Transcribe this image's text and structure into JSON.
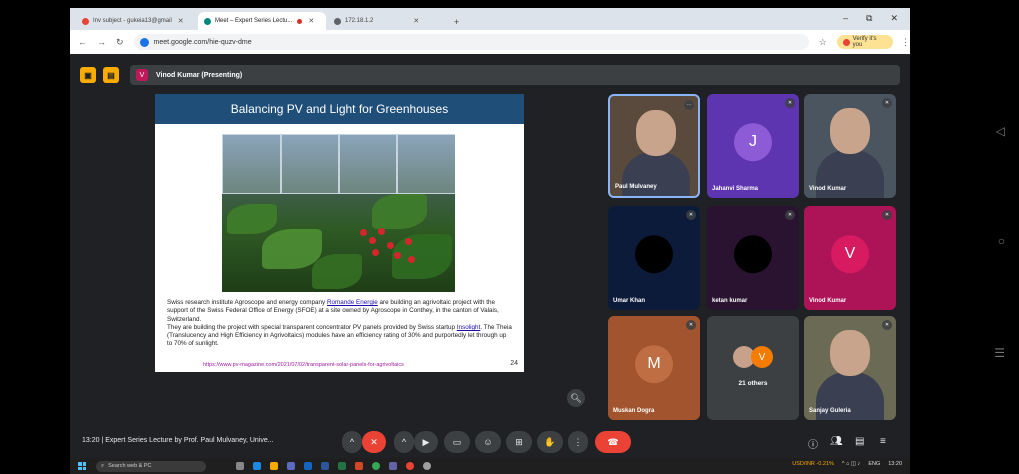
{
  "browser": {
    "tabs": [
      {
        "title": "Inv subject - gukeia13@gmail",
        "fav": "#ea4335",
        "active": false
      },
      {
        "title": "Meet – Expert Series Lectu...",
        "fav": "#00897b",
        "active": true,
        "recording": true
      },
      {
        "title": "172.18.1.2",
        "fav": "#5f6368",
        "active": false
      }
    ],
    "new_tab": "+",
    "url": "meet.google.com/hie-quzv-dme",
    "verify_label": "Verify it's you",
    "window_controls": [
      "–",
      "⧉",
      "✕"
    ]
  },
  "meet": {
    "presenter_label": "Vinod Kumar (Presenting)",
    "presenter_initial": "V",
    "meeting_info": "13:20  |  Expert Series Lecture by Prof. Paul Mulvaney, Unive...",
    "others_count": "21 others"
  },
  "slide": {
    "title": "Balancing PV and Light for Greenhouses",
    "para1_a": "Swiss research institute Agroscope and energy company ",
    "para1_link": "Romande Energie",
    "para1_b": " are building an agrivoltaic project with the support of the Swiss Federal Office of Energy (SFOE) at a site owned by Agroscope in Conthey, in the canton of Valais, Switzerland.",
    "para2_a": "They are building the project with special transparent concentrator PV panels provided by Swiss startup ",
    "para2_link": "Insolight",
    "para2_b": ". The Theia (Translucency and High Efficiency in Agrivoltaics) modules have an efficiency rating of 30% and purportedly let through up to 70% of sunlight.",
    "url": "https://www.pv-magazine.com/2021/07/02/transparent-solar-panels-for-agrivoltaics",
    "page_number": "24"
  },
  "participants": [
    {
      "name": "Paul Mulvaney",
      "initial": "",
      "bg": "#5a4a3e",
      "video": true
    },
    {
      "name": "Jahanvi Sharma",
      "initial": "J",
      "bg": "#5e35b1",
      "avatar": "#8e5bd6"
    },
    {
      "name": "Vinod Kumar",
      "initial": "",
      "bg": "#4a5560",
      "video": true
    },
    {
      "name": "Umar Khan",
      "initial": "",
      "bg": "#0d1b3a",
      "avatar": "#000"
    },
    {
      "name": "ketan kumar",
      "initial": "",
      "bg": "#2a1330",
      "avatar": "#000"
    },
    {
      "name": "Vinod Kumar",
      "initial": "V",
      "bg": "#ad1457",
      "avatar": "#d81b60"
    },
    {
      "name": "Muskan Dogra",
      "initial": "M",
      "bg": "#a1542d",
      "avatar": "#bf6d42"
    },
    {
      "name": "21 others",
      "initial": "V",
      "bg": "#3c4043",
      "avatar": "#f57c00"
    },
    {
      "name": "Sanjay Guleria",
      "initial": "",
      "bg": "#6b6a55",
      "video": true
    }
  ],
  "taskbar": {
    "search_placeholder": "Search web & PC",
    "stock": "USD/INR -0.21%",
    "lang": "ENG",
    "time": "13:20"
  }
}
